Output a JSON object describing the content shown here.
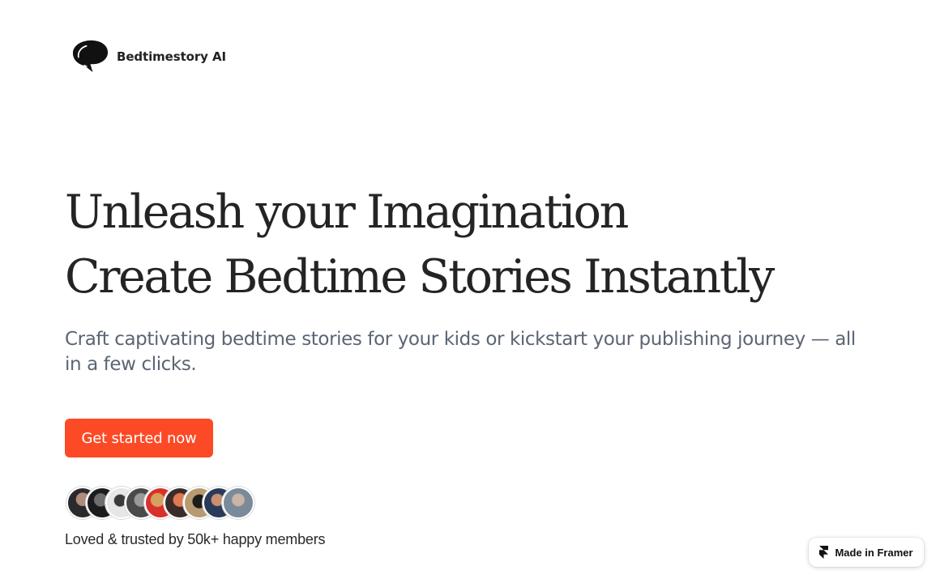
{
  "brand": {
    "name": "Bedtimestory AI",
    "logo_icon": "speech-bubble-icon"
  },
  "hero": {
    "title_line1": "Unleash your Imagination",
    "title_line2": "Create Bedtime Stories Instantly",
    "subtitle": "Craft captivating bedtime stories for your kids or kickstart your publishing journey — all in a few clicks.",
    "cta_label": "Get started now"
  },
  "social_proof": {
    "avatar_count": 9,
    "text": "Loved & trusted by 50k+ happy members"
  },
  "framer_badge": {
    "label": "Made in Framer",
    "icon": "framer-icon"
  },
  "colors": {
    "accent": "#fc4a26",
    "heading": "#242424",
    "subtitle": "#5b6573"
  }
}
